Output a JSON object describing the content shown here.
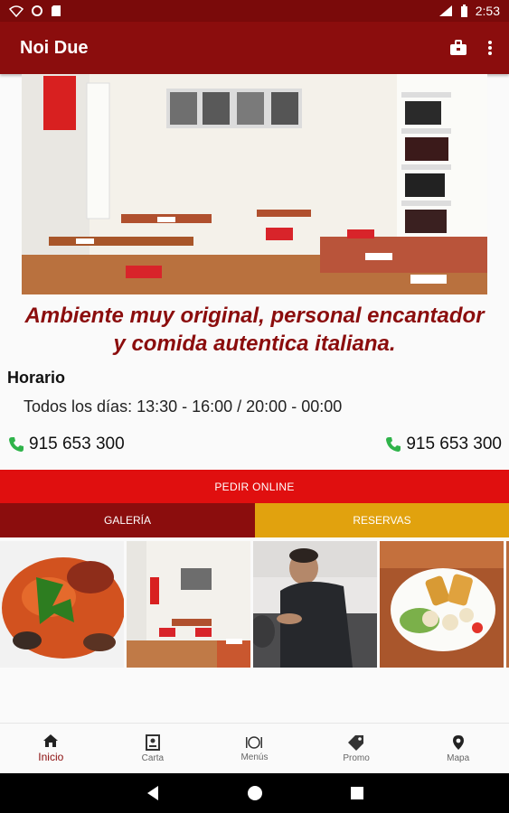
{
  "status_bar": {
    "time": "2:53"
  },
  "app_bar": {
    "title": "Noi Due"
  },
  "info": {
    "tagline_line1": "Ambiente muy original, personal encantador",
    "tagline_line2": "y comida autentica italiana.",
    "horario_title": "Horario",
    "horario_text": "Todos los días: 13:30 - 16:00 / 20:00 - 00:00",
    "phone_left": "915 653 300",
    "phone_right": "915 653 300"
  },
  "actions": {
    "pedir_online": "PEDIR ONLINE",
    "galeria": "GALERÍA",
    "reservas": "RESERVAS"
  },
  "bottom_nav": [
    {
      "label": "Inicio",
      "icon": "home-icon"
    },
    {
      "label": "Carta",
      "icon": "menu-card-icon"
    },
    {
      "label": "Menús",
      "icon": "plate-icon"
    },
    {
      "label": "Promo",
      "icon": "tag-icon"
    },
    {
      "label": "Mapa",
      "icon": "map-pin-icon"
    }
  ],
  "colors": {
    "brand": "#8b0d0d",
    "online_button": "#e00f0f",
    "reservas_button": "#e1a20e",
    "phone_icon": "#2fb34a"
  }
}
